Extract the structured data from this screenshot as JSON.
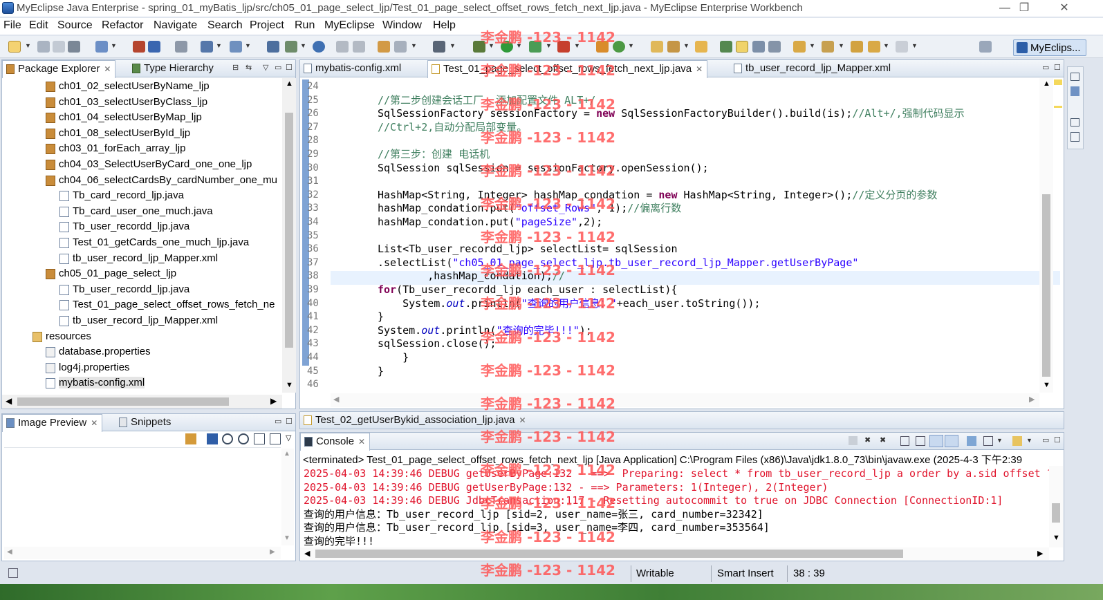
{
  "window": {
    "title": "MyEclipse Java Enterprise - spring_01_myBatis_ljp/src/ch05_01_page_select_ljp/Test_01_page_select_offset_rows_fetch_next_ljp.java - MyEclipse Enterprise Workbench",
    "minimize": "—",
    "restore": "❐",
    "close": "✕"
  },
  "menu": [
    "File",
    "Edit",
    "Source",
    "Refactor",
    "Navigate",
    "Search",
    "Project",
    "Run",
    "MyEclipse",
    "Window",
    "Help"
  ],
  "perspective": {
    "label": "MyEclips..."
  },
  "explorer": {
    "tabs": [
      {
        "label": "Package Explorer",
        "close": "✕"
      },
      {
        "label": "Type Hierarchy"
      }
    ],
    "items": [
      {
        "label": "ch01_02_selectUserByName_ljp",
        "kind": "pkg",
        "indent": 0
      },
      {
        "label": "ch01_03_selectUserByClass_ljp",
        "kind": "pkg",
        "indent": 0
      },
      {
        "label": "ch01_04_selectUserByMap_ljp",
        "kind": "pkg",
        "indent": 0
      },
      {
        "label": "ch01_08_selectUserById_ljp",
        "kind": "pkg",
        "indent": 0
      },
      {
        "label": "ch03_01_forEach_array_ljp",
        "kind": "pkg",
        "indent": 0
      },
      {
        "label": "ch04_03_SelectUserByCard_one_one_ljp",
        "kind": "pkg",
        "indent": 0
      },
      {
        "label": "ch04_06_selectCardsBy_cardNumber_one_mu",
        "kind": "pkg",
        "indent": 0
      },
      {
        "label": "Tb_card_record_ljp.java",
        "kind": "java",
        "indent": 1
      },
      {
        "label": "Tb_card_user_one_much.java",
        "kind": "java",
        "indent": 1
      },
      {
        "label": "Tb_user_recordd_ljp.java",
        "kind": "java",
        "indent": 1
      },
      {
        "label": "Test_01_getCards_one_much_ljp.java",
        "kind": "java",
        "indent": 1
      },
      {
        "label": "tb_user_record_ljp_Mapper.xml",
        "kind": "xml",
        "indent": 1
      },
      {
        "label": "ch05_01_page_select_ljp",
        "kind": "pkg",
        "indent": 0
      },
      {
        "label": "Tb_user_recordd_ljp.java",
        "kind": "java",
        "indent": 1
      },
      {
        "label": "Test_01_page_select_offset_rows_fetch_ne",
        "kind": "java",
        "indent": 1
      },
      {
        "label": "tb_user_record_ljp_Mapper.xml",
        "kind": "xml",
        "indent": 1
      },
      {
        "label": "resources",
        "kind": "folder",
        "indent": -1
      },
      {
        "label": "database.properties",
        "kind": "props",
        "indent": 0
      },
      {
        "label": "log4j.properties",
        "kind": "props",
        "indent": 0
      },
      {
        "label": "mybatis-config.xml",
        "kind": "xml",
        "indent": 0,
        "selected": true
      }
    ]
  },
  "image_preview": {
    "tabs": [
      {
        "label": "Image Preview",
        "close": "✕"
      },
      {
        "label": "Snippets"
      }
    ]
  },
  "editor": {
    "tabs": [
      {
        "label": "mybatis-config.xml"
      },
      {
        "label": "Test_01_page_select_offset_rows_fetch_next_ljp.java",
        "close": "✕",
        "active": true
      },
      {
        "label": "tb_user_record_ljp_Mapper.xml"
      }
    ],
    "lines": [
      {
        "n": "24",
        "html": ""
      },
      {
        "n": "25",
        "html": "<span class='cmt'>//第二步创建会话工厂  添加配置文件 ALT+/</span>"
      },
      {
        "n": "26",
        "html": "SqlSessionFactory sessionFactory = <span class='kw'>new</span> SqlSessionFactoryBuilder().build(is);<span class='cmt'>//Alt+/,强制代码显示</span>"
      },
      {
        "n": "27",
        "html": "<span class='cmt'>//Ctrl+2,自动分配局部变量。</span>"
      },
      {
        "n": "28",
        "html": ""
      },
      {
        "n": "29",
        "html": "<span class='cmt'>//第三步：创建 电话机</span>"
      },
      {
        "n": "30",
        "html": "SqlSession sqlSession = sessionFactory.openSession();"
      },
      {
        "n": "31",
        "html": ""
      },
      {
        "n": "32",
        "html": "HashMap&lt;String, Integer&gt; hashMap_condation = <span class='kw'>new</span> HashMap&lt;String, Integer&gt;();<span class='cmt'>//定义分页的参数</span>"
      },
      {
        "n": "33",
        "html": "hashMap_condation.put(<span class='str'>\"offset_Rows\"</span>, 1);<span class='cmt'>//偏离行数</span>"
      },
      {
        "n": "34",
        "html": "hashMap_condation.put(<span class='str'>\"pageSize\"</span>,2);"
      },
      {
        "n": "35",
        "html": ""
      },
      {
        "n": "36",
        "html": "List&lt;Tb_user_recordd_ljp&gt; selectList= sqlSession"
      },
      {
        "n": "37",
        "html": ".selectList(<span class='str'>\"ch05_01_page_select_ljp.tb_user_record_ljp_Mapper.getUserByPage\"</span>"
      },
      {
        "n": "38",
        "html": "        ,hashMap_condation);<span class='cmt'>//</span>"
      },
      {
        "n": "39",
        "html": "<span class='kw'>for</span>(Tb_user_recordd_ljp each_user : selectList){"
      },
      {
        "n": "40",
        "html": "    System.<span class='fld'>out</span>.println(<span class='str'>\"查询的用户信息：\"</span>+each_user.toString());"
      },
      {
        "n": "41",
        "html": "}"
      },
      {
        "n": "42",
        "html": "System.<span class='fld'>out</span>.println(<span class='str'>\"查询的完毕!!!\"</span>);"
      },
      {
        "n": "43",
        "html": "sqlSession.close();"
      },
      {
        "n": "44",
        "html": "    }"
      },
      {
        "n": "45",
        "html": "}"
      },
      {
        "n": "46",
        "html": ""
      }
    ]
  },
  "second_editor_tab": {
    "label": "Test_02_getUserBykid_association_ljp.java",
    "close": "✕"
  },
  "console": {
    "tab": {
      "label": "Console",
      "close": "✕"
    },
    "header": "<terminated> Test_01_page_select_offset_rows_fetch_next_ljp [Java Application] C:\\Program Files (x86)\\Java\\jdk1.8.0_73\\bin\\javaw.exe (2025-4-3 下午2:39",
    "lines": [
      {
        "text": "2025-04-03 14:39:46 DEBUG getUserByPage:132 - ==>  Preparing: select * from tb_user_record_ljp a order by a.sid offset ? r",
        "red": true
      },
      {
        "text": "2025-04-03 14:39:46 DEBUG getUserByPage:132 - ==> Parameters: 1(Integer), 2(Integer)",
        "red": true
      },
      {
        "text": "2025-04-03 14:39:46 DEBUG JdbcTransaction:117 - Resetting autocommit to true on JDBC Connection [ConnectionID:1]",
        "red": true
      },
      {
        "text": "查询的用户信息：Tb_user_record_ljp [sid=2, user_name=张三, card_number=32342]",
        "red": false
      },
      {
        "text": "查询的用户信息：Tb_user_record_ljp [sid=3, user_name=李四, card_number=353564]",
        "red": false
      },
      {
        "text": "查询的完毕!!!",
        "red": false
      }
    ]
  },
  "status": {
    "mode": "Writable",
    "insert": "Smart Insert",
    "position": "38 : 39"
  },
  "watermark": "李金鹏 -123 - 1142"
}
